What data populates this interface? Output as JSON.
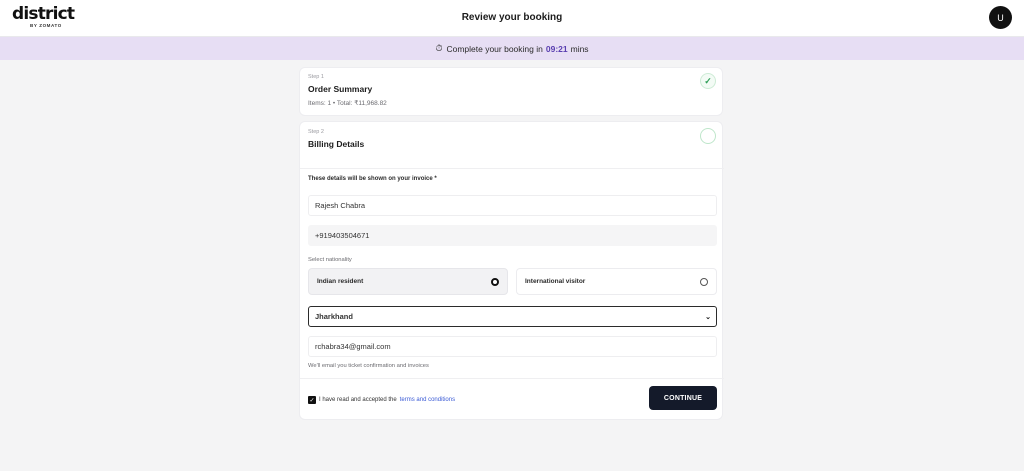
{
  "header": {
    "logo_text": "district",
    "logo_subtext": "BY ZOMATO",
    "title": "Review your booking",
    "avatar_initial": "U"
  },
  "timer": {
    "icon": "stopwatch-icon",
    "prefix": "Complete your booking in",
    "time": "09:21",
    "suffix": "mins"
  },
  "steps": {
    "step1": {
      "label": "Step 1",
      "title": "Order Summary",
      "meta": "Items: 1 • Total: ₹11,968.82",
      "status": "complete"
    },
    "step2": {
      "label": "Step 2",
      "title": "Billing Details",
      "status": "in-progress"
    }
  },
  "billing": {
    "note": "These details will be shown on your invoice *",
    "name_value": "Rajesh Chabra",
    "phone_value": "+919403504671",
    "nationality_label": "Select nationality",
    "nationality_options": [
      {
        "label": "Indian resident",
        "selected": true
      },
      {
        "label": "International visitor",
        "selected": false
      }
    ],
    "state_value": "Jharkhand",
    "email_value": "rchabra34@gmail.com",
    "email_hint": "We'll email you ticket confirmation and invoices",
    "terms_prefix": "I have read and accepted the",
    "terms_link": "terms and conditions",
    "terms_checked": true,
    "continue_label": "CONTINUE"
  },
  "colors": {
    "accent": "#5a3fb0",
    "timer_bg": "#e7def4",
    "button_bg": "#141a2a",
    "success": "#2e9e57",
    "link": "#3b5bd6"
  }
}
